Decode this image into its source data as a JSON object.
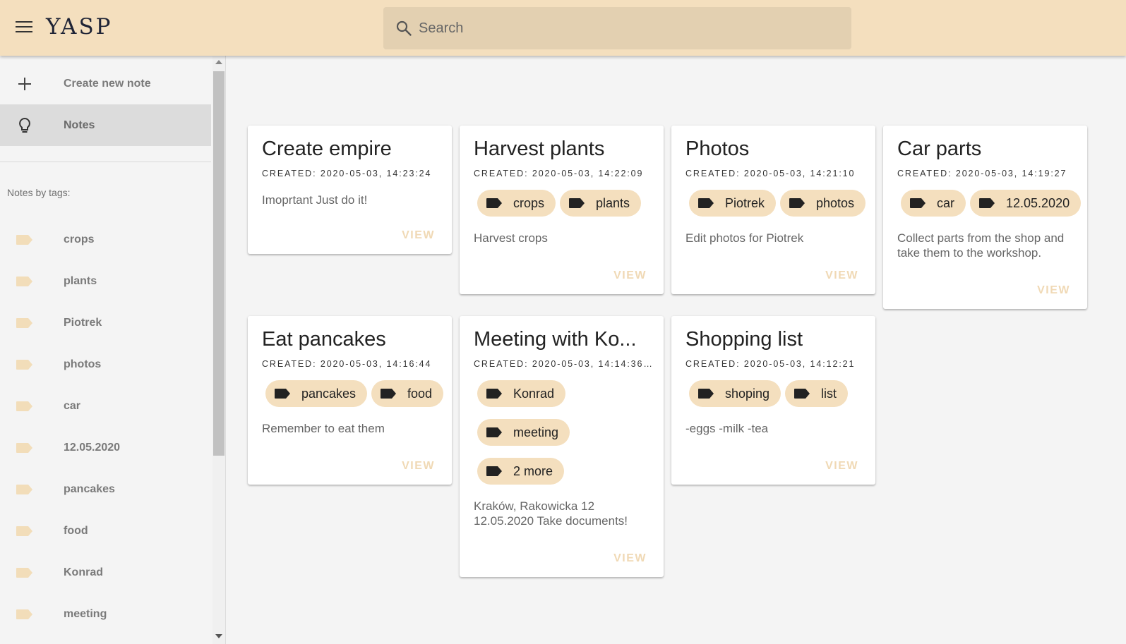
{
  "app": {
    "logo": "YASP"
  },
  "search": {
    "placeholder": "Search"
  },
  "sidebar": {
    "create_label": "Create new note",
    "notes_label": "Notes",
    "tags_header": "Notes by tags:",
    "tags": [
      "crops",
      "plants",
      "Piotrek",
      "photos",
      "car",
      "12.05.2020",
      "pancakes",
      "food",
      "Konrad",
      "meeting"
    ]
  },
  "colors": {
    "accent": "#f4dfbe",
    "view": "#f0d9b5",
    "tag_icon": "#f2ddb9"
  },
  "notes": [
    {
      "title": "Create empire",
      "created": "CREATED: 2020-05-03, 14:23:24",
      "tags": [],
      "text": "Imoprtant Just do it!",
      "view": "VIEW"
    },
    {
      "title": "Harvest plants",
      "created": "CREATED: 2020-05-03, 14:22:09",
      "tags": [
        "crops",
        "plants"
      ],
      "text": "Harvest crops",
      "view": "VIEW"
    },
    {
      "title": "Photos",
      "created": "CREATED: 2020-05-03, 14:21:10",
      "tags": [
        "Piotrek",
        "photos"
      ],
      "text": "Edit photos for Piotrek",
      "view": "VIEW"
    },
    {
      "title": "Car parts",
      "created": "CREATED: 2020-05-03, 14:19:27",
      "tags": [
        "car",
        "12.05.2020"
      ],
      "text": "Collect parts from the shop and take them to the workshop.",
      "view": "VIEW"
    },
    {
      "title": "Eat pancakes",
      "created": "CREATED: 2020-05-03, 14:16:44",
      "tags": [
        "pancakes",
        "food"
      ],
      "text": "Remember to eat them",
      "view": "VIEW"
    },
    {
      "title": "Meeting with Ko...",
      "created": "CREATED: 2020-05-03, 14:14:36...",
      "tags": [
        "Konrad",
        "meeting",
        "2 more"
      ],
      "text": "Kraków, Rakowicka 12 12.05.2020 Take documents!",
      "view": "VIEW"
    },
    {
      "title": "Shopping list",
      "created": "CREATED: 2020-05-03, 14:12:21",
      "tags": [
        "shoping",
        "list"
      ],
      "text": "-eggs -milk -tea",
      "view": "VIEW"
    }
  ]
}
